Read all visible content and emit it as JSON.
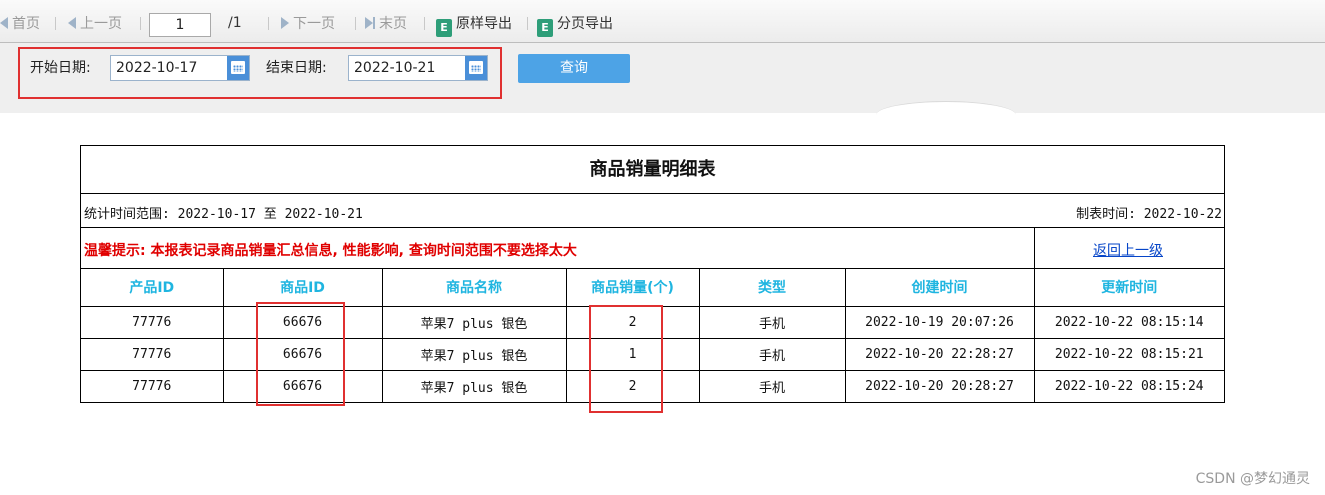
{
  "toolbar": {
    "first": "首页",
    "prev": "上一页",
    "page_value": "1",
    "page_total": "/1",
    "next": "下一页",
    "last": "末页",
    "export_original": "原样导出",
    "export_paged": "分页导出"
  },
  "query": {
    "start_label": "开始日期:",
    "start_value": "2022-10-17",
    "end_label": "结束日期:",
    "end_value": "2022-10-21",
    "button": "查询"
  },
  "report": {
    "title": "商品销量明细表",
    "range_text": "统计时间范围: 2022-10-17 至 2022-10-21",
    "made_text": "制表时间: 2022-10-22",
    "notice": "温馨提示: 本报表记录商品销量汇总信息, 性能影响, 查询时间范围不要选择太大",
    "back_link": "返回上一级",
    "columns": [
      "产品ID",
      "商品ID",
      "商品名称",
      "商品销量(个)",
      "类型",
      "创建时间",
      "更新时间"
    ],
    "rows": [
      [
        "77776",
        "66676",
        "苹果7 plus 银色",
        "2",
        "手机",
        "2022-10-19 20:07:26",
        "2022-10-22 08:15:14"
      ],
      [
        "77776",
        "66676",
        "苹果7 plus 银色",
        "1",
        "手机",
        "2022-10-20 22:28:27",
        "2022-10-22 08:15:21"
      ],
      [
        "77776",
        "66676",
        "苹果7 plus 银色",
        "2",
        "手机",
        "2022-10-20 20:28:27",
        "2022-10-22 08:15:24"
      ]
    ]
  },
  "colors": {
    "header_text": "#1fb5e0",
    "notice_text": "#e00000",
    "highlight": "#e03030",
    "button": "#4da3e6"
  },
  "watermark": "CSDN @梦幻通灵"
}
